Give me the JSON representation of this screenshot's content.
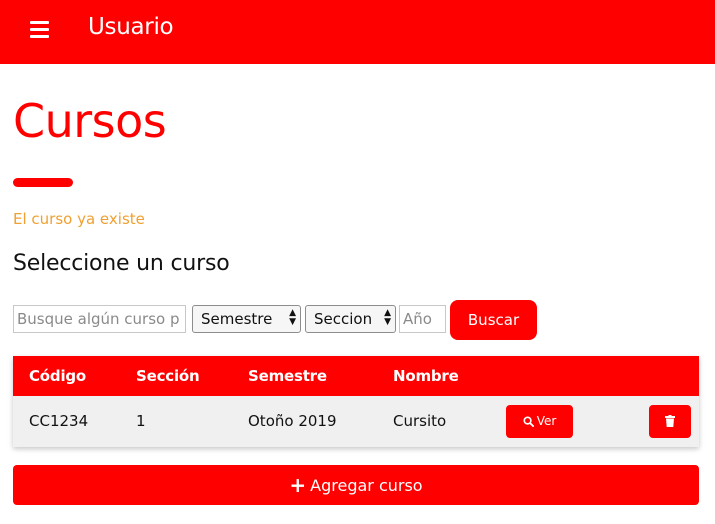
{
  "header": {
    "menu_icon": "hamburger-menu-icon",
    "title": "Usuario"
  },
  "page": {
    "title": "Cursos",
    "alert": "El curso ya existe",
    "section_title": "Seleccione un curso"
  },
  "filters": {
    "search_placeholder": "Busque algún curso p",
    "semestre_label": "Semestre",
    "seccion_label": "Seccion",
    "year_placeholder": "Año",
    "search_button": "Buscar"
  },
  "table": {
    "headers": [
      "Código",
      "Sección",
      "Semestre",
      "Nombre"
    ],
    "rows": [
      {
        "codigo": "CC1234",
        "seccion": "1",
        "semestre": "Otoño 2019",
        "nombre": "Cursito",
        "view_label": "Ver",
        "view_icon": "search-icon",
        "delete_icon": "trash-icon"
      }
    ]
  },
  "actions": {
    "add_label": "Agregar curso",
    "add_icon": "plus-icon"
  },
  "colors": {
    "accent": "#ff0000",
    "alert": "#f0a030",
    "row_background": "#f0f0f0"
  }
}
